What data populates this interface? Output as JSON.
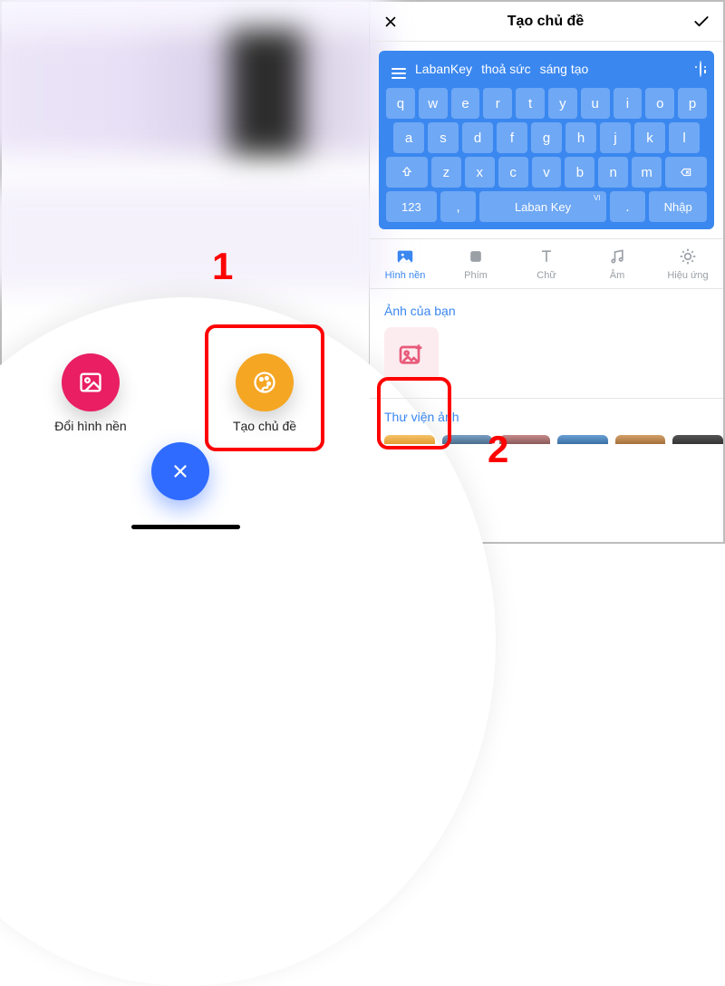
{
  "annotations": {
    "step1": "1",
    "step2": "2"
  },
  "left": {
    "options": {
      "change_bg": {
        "label": "Đổi hình nền",
        "icon": "image-icon",
        "color": "#e91e63"
      },
      "create_theme": {
        "label": "Tạo chủ đề",
        "icon": "palette-icon",
        "color": "#f5a623"
      }
    },
    "close_icon": "close-icon"
  },
  "right": {
    "header": {
      "close_icon": "close-icon",
      "title": "Tạo chủ đề",
      "confirm_icon": "checkmark-icon"
    },
    "keyboard": {
      "brand_words": [
        "LabanKey",
        "thoả sức",
        "sáng tạo"
      ],
      "rows": {
        "r1": [
          "q",
          "w",
          "e",
          "r",
          "t",
          "y",
          "u",
          "i",
          "o",
          "p"
        ],
        "r2": [
          "a",
          "s",
          "d",
          "f",
          "g",
          "h",
          "j",
          "k",
          "l"
        ],
        "r3_mid": [
          "z",
          "x",
          "c",
          "v",
          "b",
          "n",
          "m"
        ]
      },
      "numkey_label": "123",
      "comma": ",",
      "space_label": "Laban Key",
      "period": ".",
      "enter_label": "Nhập",
      "lang_badge": "VI"
    },
    "tools": [
      {
        "id": "hinh-nen",
        "label": "Hình nền",
        "icon": "image-icon",
        "active": true
      },
      {
        "id": "phim",
        "label": "Phím",
        "icon": "key-square-icon",
        "active": false
      },
      {
        "id": "chu",
        "label": "Chữ",
        "icon": "text-icon",
        "active": false
      },
      {
        "id": "am",
        "label": "Âm",
        "icon": "music-note-icon",
        "active": false
      },
      {
        "id": "hieu-ung",
        "label": "Hiệu ứng",
        "icon": "sparkle-icon",
        "active": false
      }
    ],
    "sections": {
      "your_photos": {
        "title": "Ảnh của bạn",
        "add_icon": "add-image-icon"
      },
      "library": {
        "title": "Thư viện ảnh"
      }
    }
  }
}
